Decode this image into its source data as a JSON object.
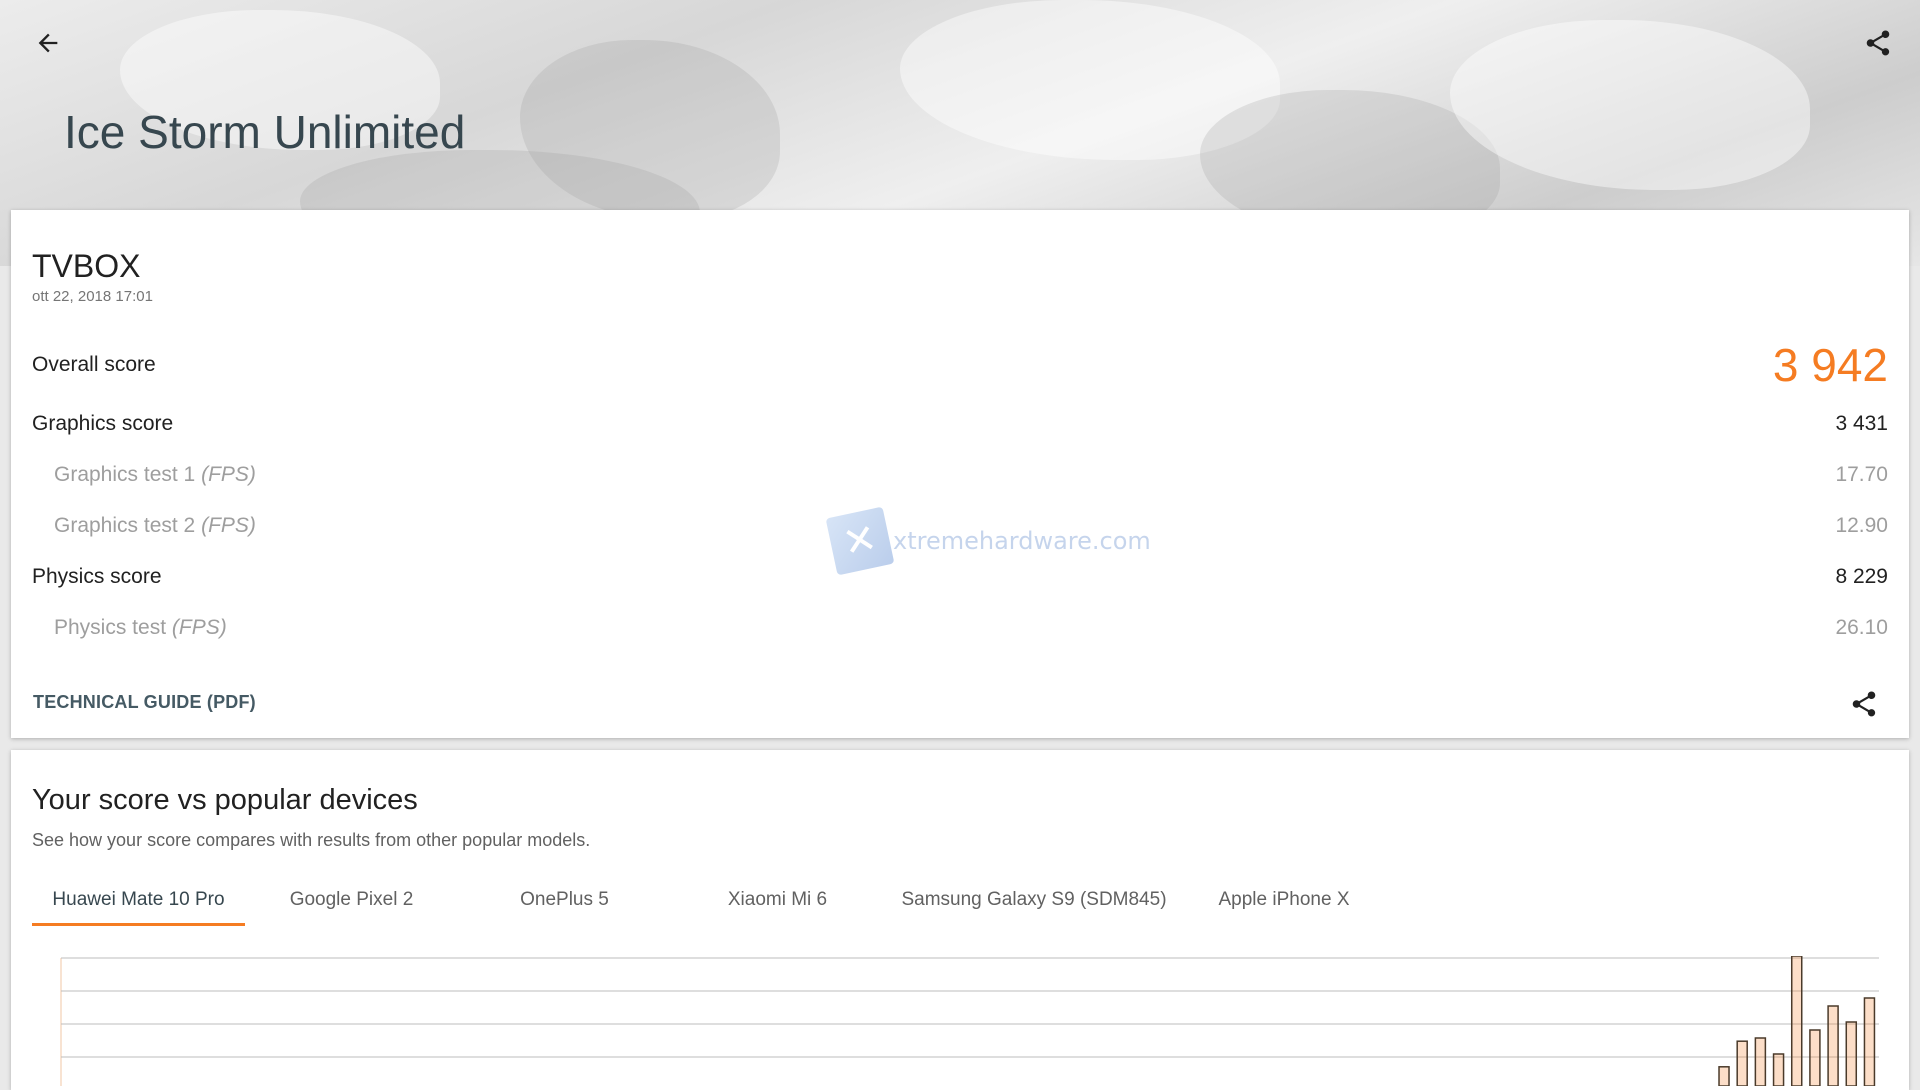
{
  "header": {
    "title": "Ice Storm Unlimited",
    "back_icon": "arrow-left-icon",
    "share_icon": "share-icon"
  },
  "result": {
    "device": "TVBOX",
    "date": "ott 22, 2018 17:01",
    "overall_label": "Overall score",
    "overall_value": "3 942",
    "graphics_label": "Graphics score",
    "graphics_value": "3 431",
    "gt1_label": "Graphics test 1",
    "gt1_unit": "(FPS)",
    "gt1_value": "17.70",
    "gt2_label": "Graphics test 2",
    "gt2_unit": "(FPS)",
    "gt2_value": "12.90",
    "physics_label": "Physics score",
    "physics_value": "8 229",
    "pt_label": "Physics test",
    "pt_unit": "(FPS)",
    "pt_value": "26.10",
    "guide_label": "TECHNICAL GUIDE (PDF)",
    "accent_color": "#f57c22"
  },
  "watermark": {
    "text": "xtremehardware.com"
  },
  "compare": {
    "title": "Your score vs popular devices",
    "description": "See how your score compares with results from other popular models.",
    "tabs": [
      {
        "label": "Huawei Mate 10 Pro"
      },
      {
        "label": "Google Pixel 2"
      },
      {
        "label": "OnePlus 5"
      },
      {
        "label": "Xiaomi Mi 6"
      },
      {
        "label": "Samsung Galaxy S9 (SDM845)"
      },
      {
        "label": "Apple iPhone X"
      }
    ],
    "active_tab": 0
  },
  "chart_data": {
    "type": "bar",
    "x_index": [
      0,
      1,
      2,
      3,
      4,
      5,
      6,
      7,
      8,
      9,
      10,
      11,
      12,
      13,
      14,
      15,
      16,
      17,
      18,
      19,
      20,
      21,
      22,
      23,
      24,
      25,
      26,
      27,
      28,
      29,
      30,
      31,
      32,
      33,
      34,
      35,
      36,
      37,
      38,
      39,
      40,
      41,
      42,
      43,
      44,
      45,
      46,
      47,
      48,
      49,
      50,
      51,
      52,
      53,
      54,
      55,
      56,
      57,
      58,
      59,
      60,
      61,
      62,
      63,
      64,
      65,
      66,
      67,
      68,
      69,
      70,
      71,
      72,
      73,
      74,
      75,
      76,
      77,
      78,
      79,
      80,
      81,
      82,
      83,
      84,
      85,
      86,
      87,
      88,
      89,
      90,
      91,
      92,
      93,
      94,
      95,
      96,
      97,
      98,
      99
    ],
    "values": [
      0,
      0,
      0,
      0,
      0,
      0,
      0,
      0,
      0,
      0,
      0,
      0,
      0,
      0,
      0,
      0,
      0,
      0,
      0,
      0,
      0,
      0,
      0,
      0,
      0,
      0,
      0,
      0,
      0,
      0,
      0,
      0,
      0,
      0,
      0,
      0,
      0,
      0,
      0,
      0,
      0,
      0,
      0,
      0,
      0,
      0,
      0,
      0,
      0,
      0,
      0,
      0,
      0,
      0,
      0,
      0,
      0,
      0,
      0,
      0,
      0,
      0,
      0,
      0,
      0,
      0,
      0,
      0,
      0,
      0,
      0,
      0,
      0,
      0,
      0,
      0,
      0,
      0,
      0,
      0,
      0,
      0,
      0,
      0,
      0,
      0,
      0,
      0,
      0,
      0,
      0,
      0.12,
      0.28,
      0.3,
      0.2,
      0.95,
      0.35,
      0.5,
      0.4,
      0.55
    ],
    "bar_color": "#f57c22",
    "bar_outline": "#4a3a2a",
    "grid": true
  }
}
